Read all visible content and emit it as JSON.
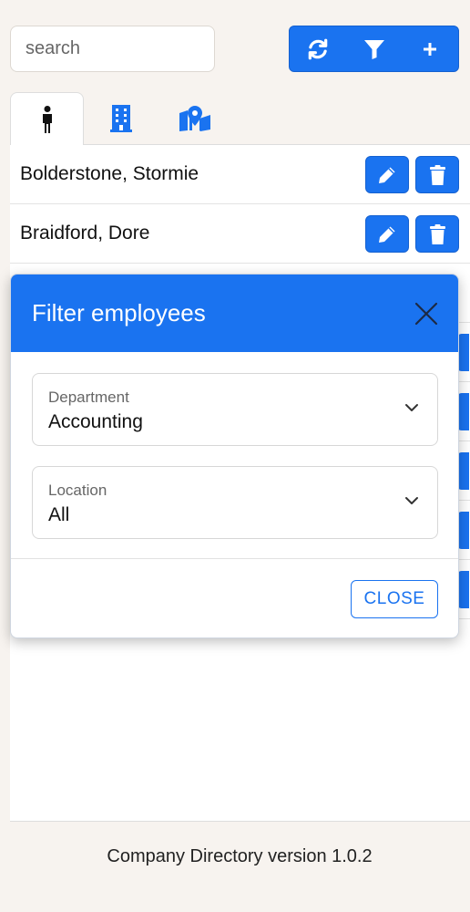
{
  "search": {
    "placeholder": "search"
  },
  "toolbar": {
    "buttons": [
      {
        "icon": "refresh-icon"
      },
      {
        "icon": "filter-icon"
      },
      {
        "icon": "plus-icon"
      }
    ]
  },
  "tabs": [
    {
      "icon": "person-icon",
      "active": true
    },
    {
      "icon": "building-icon",
      "active": false
    },
    {
      "icon": "map-pin-icon",
      "active": false
    }
  ],
  "employees": [
    {
      "name": "Bolderstone, Stormie"
    },
    {
      "name": "Braidford, Dore"
    }
  ],
  "modal": {
    "title": "Filter employees",
    "department": {
      "label": "Department",
      "value": "Accounting"
    },
    "location": {
      "label": "Location",
      "value": "All"
    },
    "close_label": "CLOSE"
  },
  "footer": {
    "text": "Company Directory version 1.0.2"
  },
  "colors": {
    "accent": "#1a73f0",
    "background": "#f7f3ef"
  }
}
